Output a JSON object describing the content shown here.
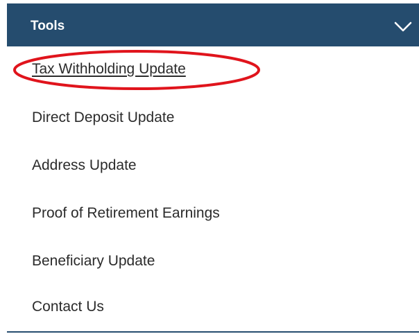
{
  "menu": {
    "title": "Tools",
    "header_icon": "chevron-down-icon",
    "header_color": "#254c6e",
    "items": [
      {
        "label": "Tax Withholding Update",
        "active": true
      },
      {
        "label": "Direct Deposit Update"
      },
      {
        "label": "Address Update"
      },
      {
        "label": "Proof of Retirement Earnings"
      },
      {
        "label": "Beneficiary Update"
      },
      {
        "label": "Contact Us"
      }
    ]
  },
  "annotation": {
    "shape": "ellipse",
    "color": "#e0141c",
    "target": "Tax Withholding Update"
  }
}
